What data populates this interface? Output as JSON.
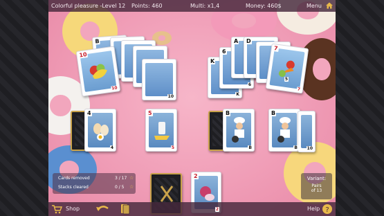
{
  "topbar": {
    "title": "Colorful pleasure -Level 12",
    "points": "Points: 460",
    "multi": "Multi: x1,4",
    "money": "Money: 460$",
    "menu": "Menu"
  },
  "bottombar": {
    "shop": "Shop",
    "help": "Help"
  },
  "stats": {
    "cards_removed_label": "Cards removed",
    "cards_removed_value": "3 / 17",
    "stacks_cleared_label": "Stacks cleared",
    "stacks_cleared_value": "0 / 5"
  },
  "variant": {
    "label": "Variant:",
    "value_line1": "Pairs",
    "value_line2": "of 13"
  },
  "cards": {
    "left_fan_top": {
      "rank": "10",
      "suit": "♦",
      "br": "10",
      "red": true
    },
    "left_fan_b": {
      "rank": "B",
      "suit": "♠",
      "br": "B"
    },
    "left_fan_10": {
      "rank": "10",
      "suit": "",
      "br": "10"
    },
    "right_fan_top": {
      "rank": "7",
      "suit": "♦",
      "br": "7",
      "red": true
    },
    "right_fan_k": {
      "rank": "K",
      "suit": "♠",
      "br": "K"
    },
    "right_fan_6": {
      "rank": "6",
      "suit": "♠",
      "br": "6"
    },
    "right_fan_a": {
      "rank": "A",
      "suit": "",
      "br": ""
    },
    "right_fan_d": {
      "rank": "D",
      "suit": "",
      "br": ""
    },
    "right_fan_5": {
      "rank": "5",
      "suit": "",
      "br": "5"
    },
    "row_4": {
      "rank": "4",
      "suit": "♠",
      "br": "4"
    },
    "row_5": {
      "rank": "5",
      "suit": "♥",
      "br": "5",
      "red": true
    },
    "row_b1": {
      "rank": "B",
      "suit": "♠",
      "br": "B"
    },
    "row_b2": {
      "rank": "B",
      "suit": "♠",
      "br": "B"
    },
    "row_10": {
      "rank": "",
      "suit": "",
      "br": "10"
    },
    "waste_2": {
      "rank": "2",
      "suit": "♥",
      "br": "2",
      "red": true
    }
  },
  "colors": {
    "table_pink": "#ef9bb5",
    "bar": "#46283c",
    "gold": "#c9a24a"
  },
  "icons": [
    "house-icon",
    "cart-icon",
    "undo-arrow-icon",
    "joker-card-icon",
    "help-icon",
    "star-icon",
    "fork-knife-icon"
  ]
}
